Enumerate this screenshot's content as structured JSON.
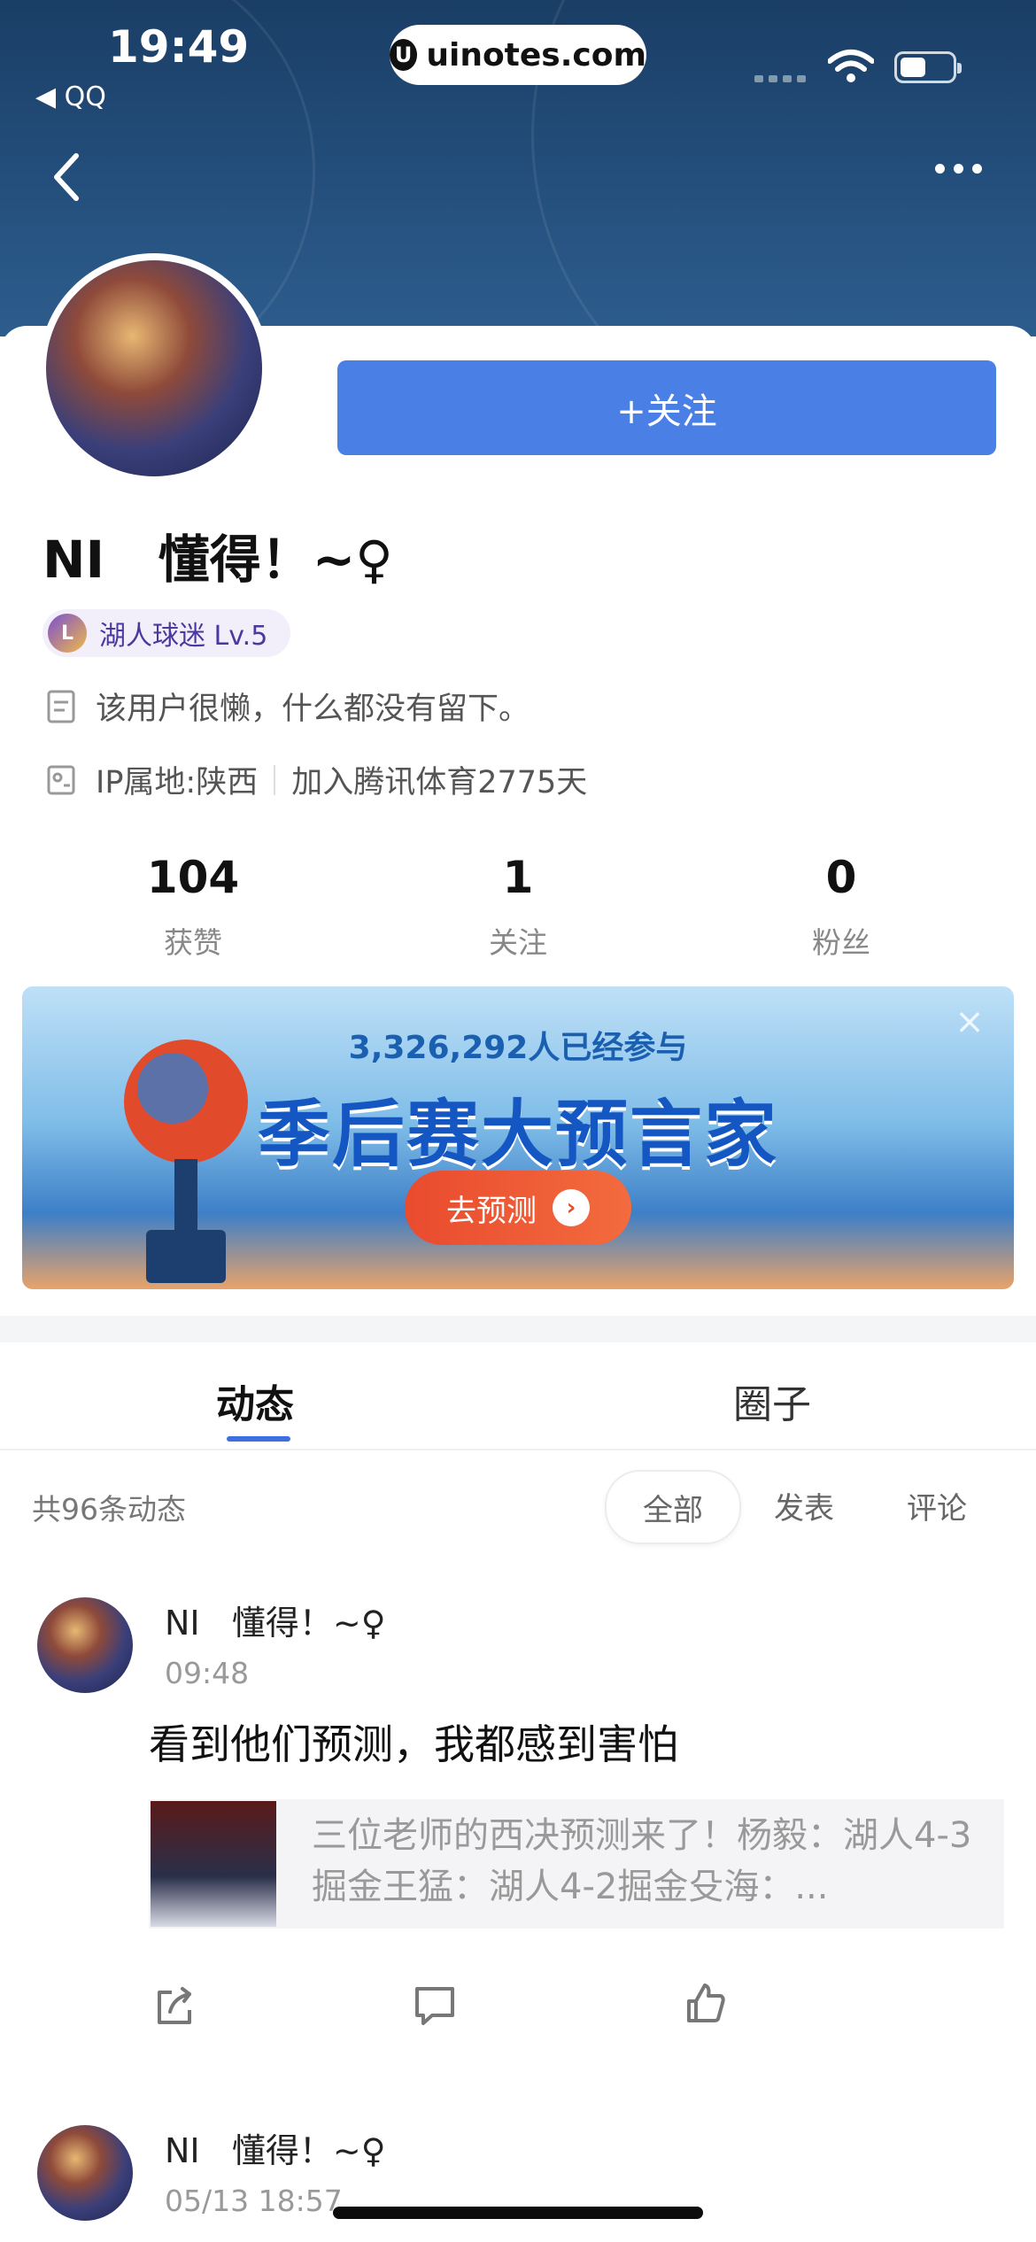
{
  "status_bar": {
    "time": "19:49",
    "back_app": "QQ",
    "url": "uinotes.com"
  },
  "profile": {
    "follow_button": "+关注",
    "username": "NI   懂得！~♀",
    "fan_badge": "湖人球迷 Lv.5",
    "bio": "该用户很懒，什么都没有留下。",
    "ip_location": "IP属地:陕西",
    "joined": "加入腾讯体育2775天"
  },
  "stats": [
    {
      "value": "104",
      "label": "获赞"
    },
    {
      "value": "1",
      "label": "关注"
    },
    {
      "value": "0",
      "label": "粉丝"
    }
  ],
  "banner": {
    "participants": "3,326,292人已经参与",
    "title": "季后赛大预言家",
    "cta": "去预测"
  },
  "tabs": [
    "动态",
    "圈子"
  ],
  "feed": {
    "count_label": "共96条动态",
    "filters": [
      "全部",
      "发表",
      "评论"
    ]
  },
  "posts": [
    {
      "author": "NI   懂得！~♀",
      "time": "09:48",
      "text": "看到他们预测，我都感到害怕",
      "link_text": "三位老师的西决预测来了！杨毅：湖人4-3掘金王猛：湖人4-2掘金殳海：..."
    },
    {
      "author": "NI   懂得！~♀",
      "time": "05/13 18:57"
    }
  ],
  "colors": {
    "accent": "#4a7fe6",
    "tab_indicator": "#3d6fe0",
    "hero_bg": "#1a3e66"
  }
}
